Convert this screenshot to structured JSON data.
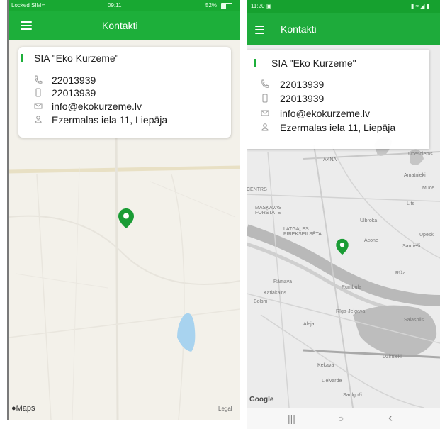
{
  "ios": {
    "status": {
      "carrier": "Locked SIM",
      "time": "09:11",
      "battery": "52%"
    },
    "app_title": "Kontakti",
    "company": "SIA \"Eko Kurzeme\"",
    "phone": "22013939",
    "mobile": "22013939",
    "email": "info@ekokurzeme.lv",
    "address": "Ezermalas iela 11, Liepāja",
    "map_attribution_left": "Maps",
    "map_attribution_right": "Legal",
    "icons": {
      "menu": "hamburger-icon",
      "phone": "phone-icon",
      "mobile": "mobile-icon",
      "email": "envelope-icon",
      "address": "person-location-icon",
      "pin": "map-pin-icon"
    }
  },
  "android": {
    "status": {
      "time": "11:20"
    },
    "app_title": "Kontakti",
    "company": "SIA \"Eko Kurzeme\"",
    "phone": "22013939",
    "mobile": "22013939",
    "email": "info@ekokurzeme.lv",
    "address": "Ezermalas iela 11, Liepāja",
    "map_labels": [
      "Ubesciems",
      "AKNA",
      "Amatnieki",
      "Muce",
      "CENTRS",
      "MASKAVAS FORŠTATE",
      "Lits",
      "LATGALES PRIEKŠPILSĒTA",
      "Ulbroka",
      "Upesk",
      "Acone",
      "Saurieši",
      "Rāmava",
      "Katlakalns",
      "Rumbula",
      "Bolshi",
      "Rīga-Jelgava",
      "Aleja",
      "Salaspils",
      "Dzirnieki",
      "Kekava",
      "Lielvārde",
      "Saulgoži",
      "Rīža"
    ],
    "map_attribution": "Google",
    "nav": {
      "recents": "|||",
      "home": "○",
      "back": "‹"
    },
    "colors": {
      "header": "#1eab3b",
      "accent": "#1daf3a"
    }
  }
}
